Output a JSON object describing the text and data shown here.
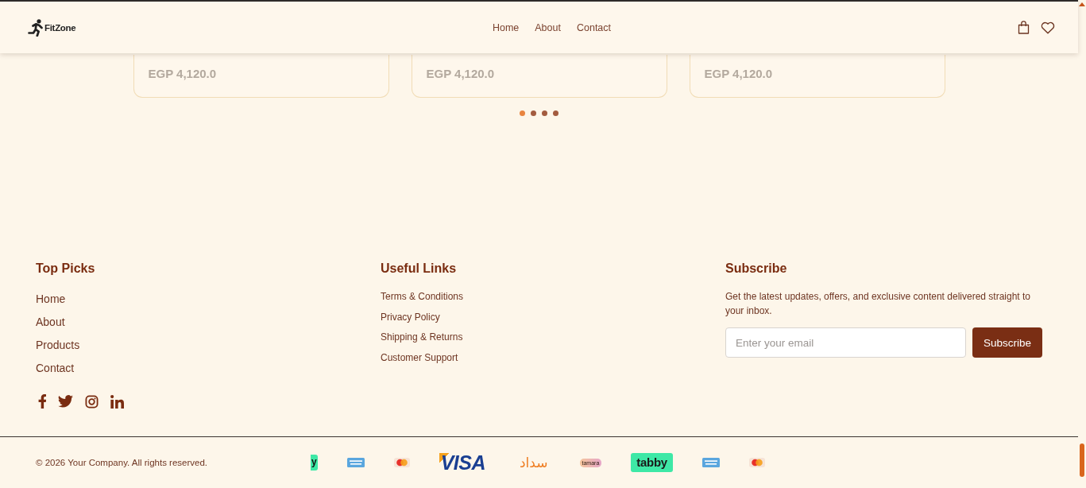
{
  "header": {
    "logo": "FitZone",
    "nav": [
      {
        "label": "Home"
      },
      {
        "label": "About"
      },
      {
        "label": "Contact"
      }
    ]
  },
  "products": {
    "cards": [
      {
        "price": "EGP 4,120.0"
      },
      {
        "price": "EGP 4,120.0"
      },
      {
        "price": "EGP 4,120.0"
      }
    ],
    "dots": [
      {
        "selected": true
      },
      {
        "selected": false
      },
      {
        "selected": false
      },
      {
        "selected": false
      }
    ]
  },
  "footer": {
    "top_picks": {
      "title": "Top Picks",
      "links": [
        "Home",
        "About",
        "Products",
        "Contact"
      ],
      "social": [
        {
          "kind": "facebook"
        },
        {
          "kind": "twitter"
        },
        {
          "kind": "instagram"
        },
        {
          "kind": "linkedin"
        }
      ]
    },
    "useful_links": {
      "title": "Useful Links",
      "links": [
        "Terms & Conditions",
        "Privacy Policy",
        "Shipping & Returns",
        "Customer Support"
      ]
    },
    "subscribe": {
      "title": "Subscribe",
      "text": "Get the latest updates, offers, and exclusive content delivered straight to your inbox.",
      "placeholder": "Enter your email",
      "button": "Subscribe"
    }
  },
  "bottom_bar": {
    "copyright": "© 2026 Your Company. All rights reserved.",
    "payment_logos": [
      {
        "kind": "tabby_cut",
        "label": "y"
      },
      {
        "kind": "amex"
      },
      {
        "kind": "mastercard"
      },
      {
        "kind": "visa",
        "label": "VISA"
      },
      {
        "kind": "sadad",
        "label": "سداد"
      },
      {
        "kind": "tamara",
        "label": "tamara"
      },
      {
        "kind": "tabby",
        "label": "tabby"
      },
      {
        "kind": "amex"
      },
      {
        "kind": "mastercard"
      }
    ]
  }
}
